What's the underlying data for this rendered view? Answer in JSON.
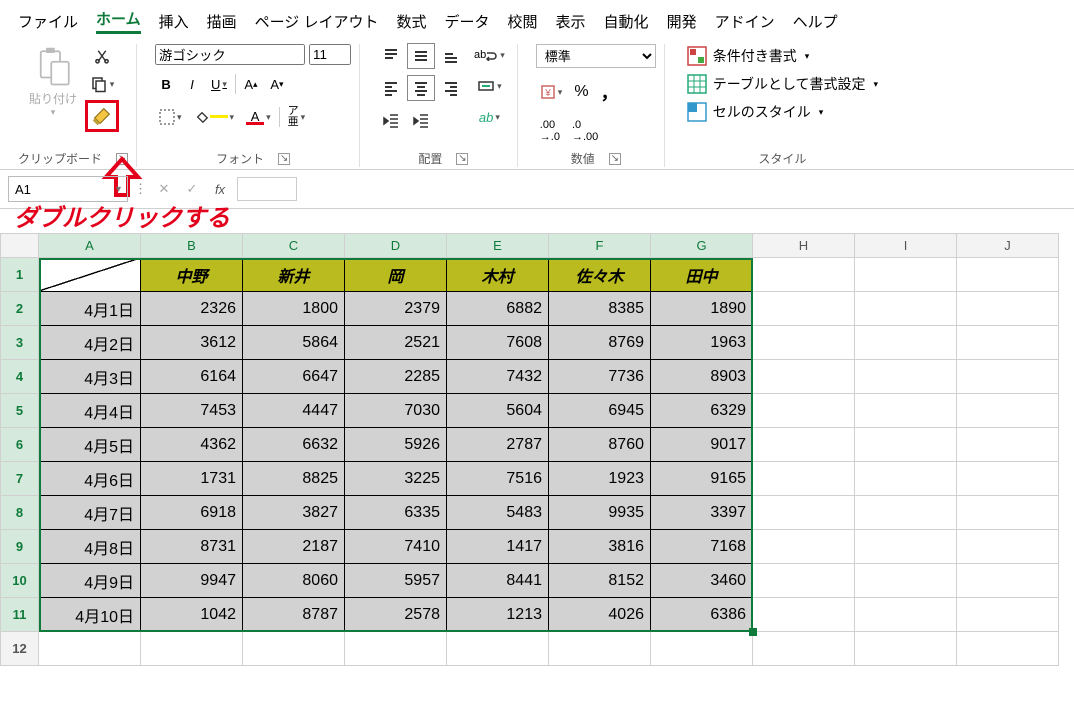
{
  "menu": {
    "items": [
      "ファイル",
      "ホーム",
      "挿入",
      "描画",
      "ページ レイアウト",
      "数式",
      "データ",
      "校閲",
      "表示",
      "自動化",
      "開発",
      "アドイン",
      "ヘルプ"
    ],
    "active_index": 1
  },
  "ribbon": {
    "clipboard": {
      "paste_label": "貼り付け",
      "group_label": "クリップボード"
    },
    "font": {
      "font_name": "游ゴシック",
      "font_size": "11",
      "bold": "B",
      "italic": "I",
      "underline": "U",
      "group_label": "フォント",
      "ruby": "ア\n亜"
    },
    "align": {
      "group_label": "配置",
      "wrap": "ab"
    },
    "number": {
      "format": "標準",
      "group_label": "数値",
      "percent": "%",
      "comma": "，"
    },
    "styles": {
      "cond": "条件付き書式",
      "table": "テーブルとして書式設定",
      "cell": "セルのスタイル",
      "group_label": "スタイル"
    }
  },
  "formula_bar": {
    "name_box": "A1",
    "fx": "fx",
    "annotation": "ダブルクリックする"
  },
  "sheet": {
    "columns": [
      "A",
      "B",
      "C",
      "D",
      "E",
      "F",
      "G",
      "H",
      "I",
      "J"
    ],
    "selected_cols": [
      0,
      1,
      2,
      3,
      4,
      5,
      6
    ],
    "selected_rows": [
      1,
      2,
      3,
      4,
      5,
      6,
      7,
      8,
      9,
      10,
      11
    ],
    "header_row": [
      "",
      "中野",
      "新井",
      "岡",
      "木村",
      "佐々木",
      "田中"
    ],
    "rows": [
      {
        "label": "4月1日",
        "v": [
          2326,
          1800,
          2379,
          6882,
          8385,
          1890
        ]
      },
      {
        "label": "4月2日",
        "v": [
          3612,
          5864,
          2521,
          7608,
          8769,
          1963
        ]
      },
      {
        "label": "4月3日",
        "v": [
          6164,
          6647,
          2285,
          7432,
          7736,
          8903
        ]
      },
      {
        "label": "4月4日",
        "v": [
          7453,
          4447,
          7030,
          5604,
          6945,
          6329
        ]
      },
      {
        "label": "4月5日",
        "v": [
          4362,
          6632,
          5926,
          2787,
          8760,
          9017
        ]
      },
      {
        "label": "4月6日",
        "v": [
          1731,
          8825,
          3225,
          7516,
          1923,
          9165
        ]
      },
      {
        "label": "4月7日",
        "v": [
          6918,
          3827,
          6335,
          5483,
          9935,
          3397
        ]
      },
      {
        "label": "4月8日",
        "v": [
          8731,
          2187,
          7410,
          1417,
          3816,
          7168
        ]
      },
      {
        "label": "4月9日",
        "v": [
          9947,
          8060,
          5957,
          8441,
          8152,
          3460
        ]
      },
      {
        "label": "4月10日",
        "v": [
          1042,
          8787,
          2578,
          1213,
          4026,
          6386
        ]
      }
    ],
    "visible_row_count": 12
  }
}
